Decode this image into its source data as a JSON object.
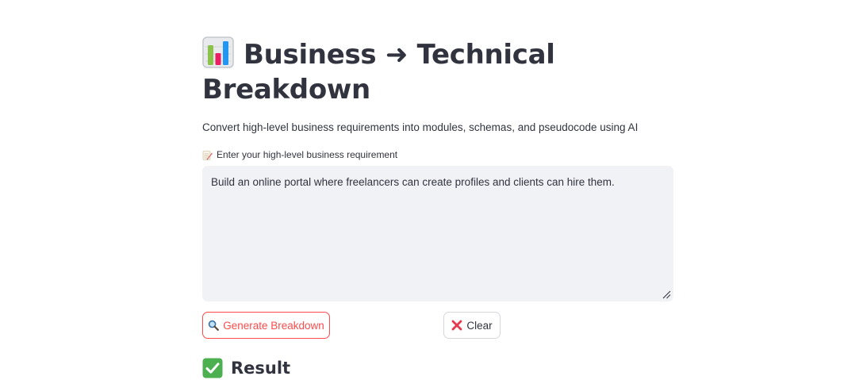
{
  "header": {
    "title": "Business ➜ Technical Breakdown",
    "title_icon": "bar-chart-icon",
    "subtitle": "Convert high-level business requirements into modules, schemas, and pseudocode using AI"
  },
  "input": {
    "label": "Enter your high-level business requirement",
    "label_icon": "memo-icon",
    "value": "Build an online portal where freelancers can create profiles and clients can hire them."
  },
  "buttons": {
    "generate_label": "Generate Breakdown",
    "generate_icon": "magnifier-icon",
    "clear_label": "Clear",
    "clear_icon": "cross-mark-icon"
  },
  "result": {
    "heading": "Result",
    "icon": "check-mark-icon"
  },
  "colors": {
    "primary": "#ff4b4b",
    "text": "#31333f",
    "input_bg": "#f0f2f6",
    "check_green": "#4caf50"
  }
}
